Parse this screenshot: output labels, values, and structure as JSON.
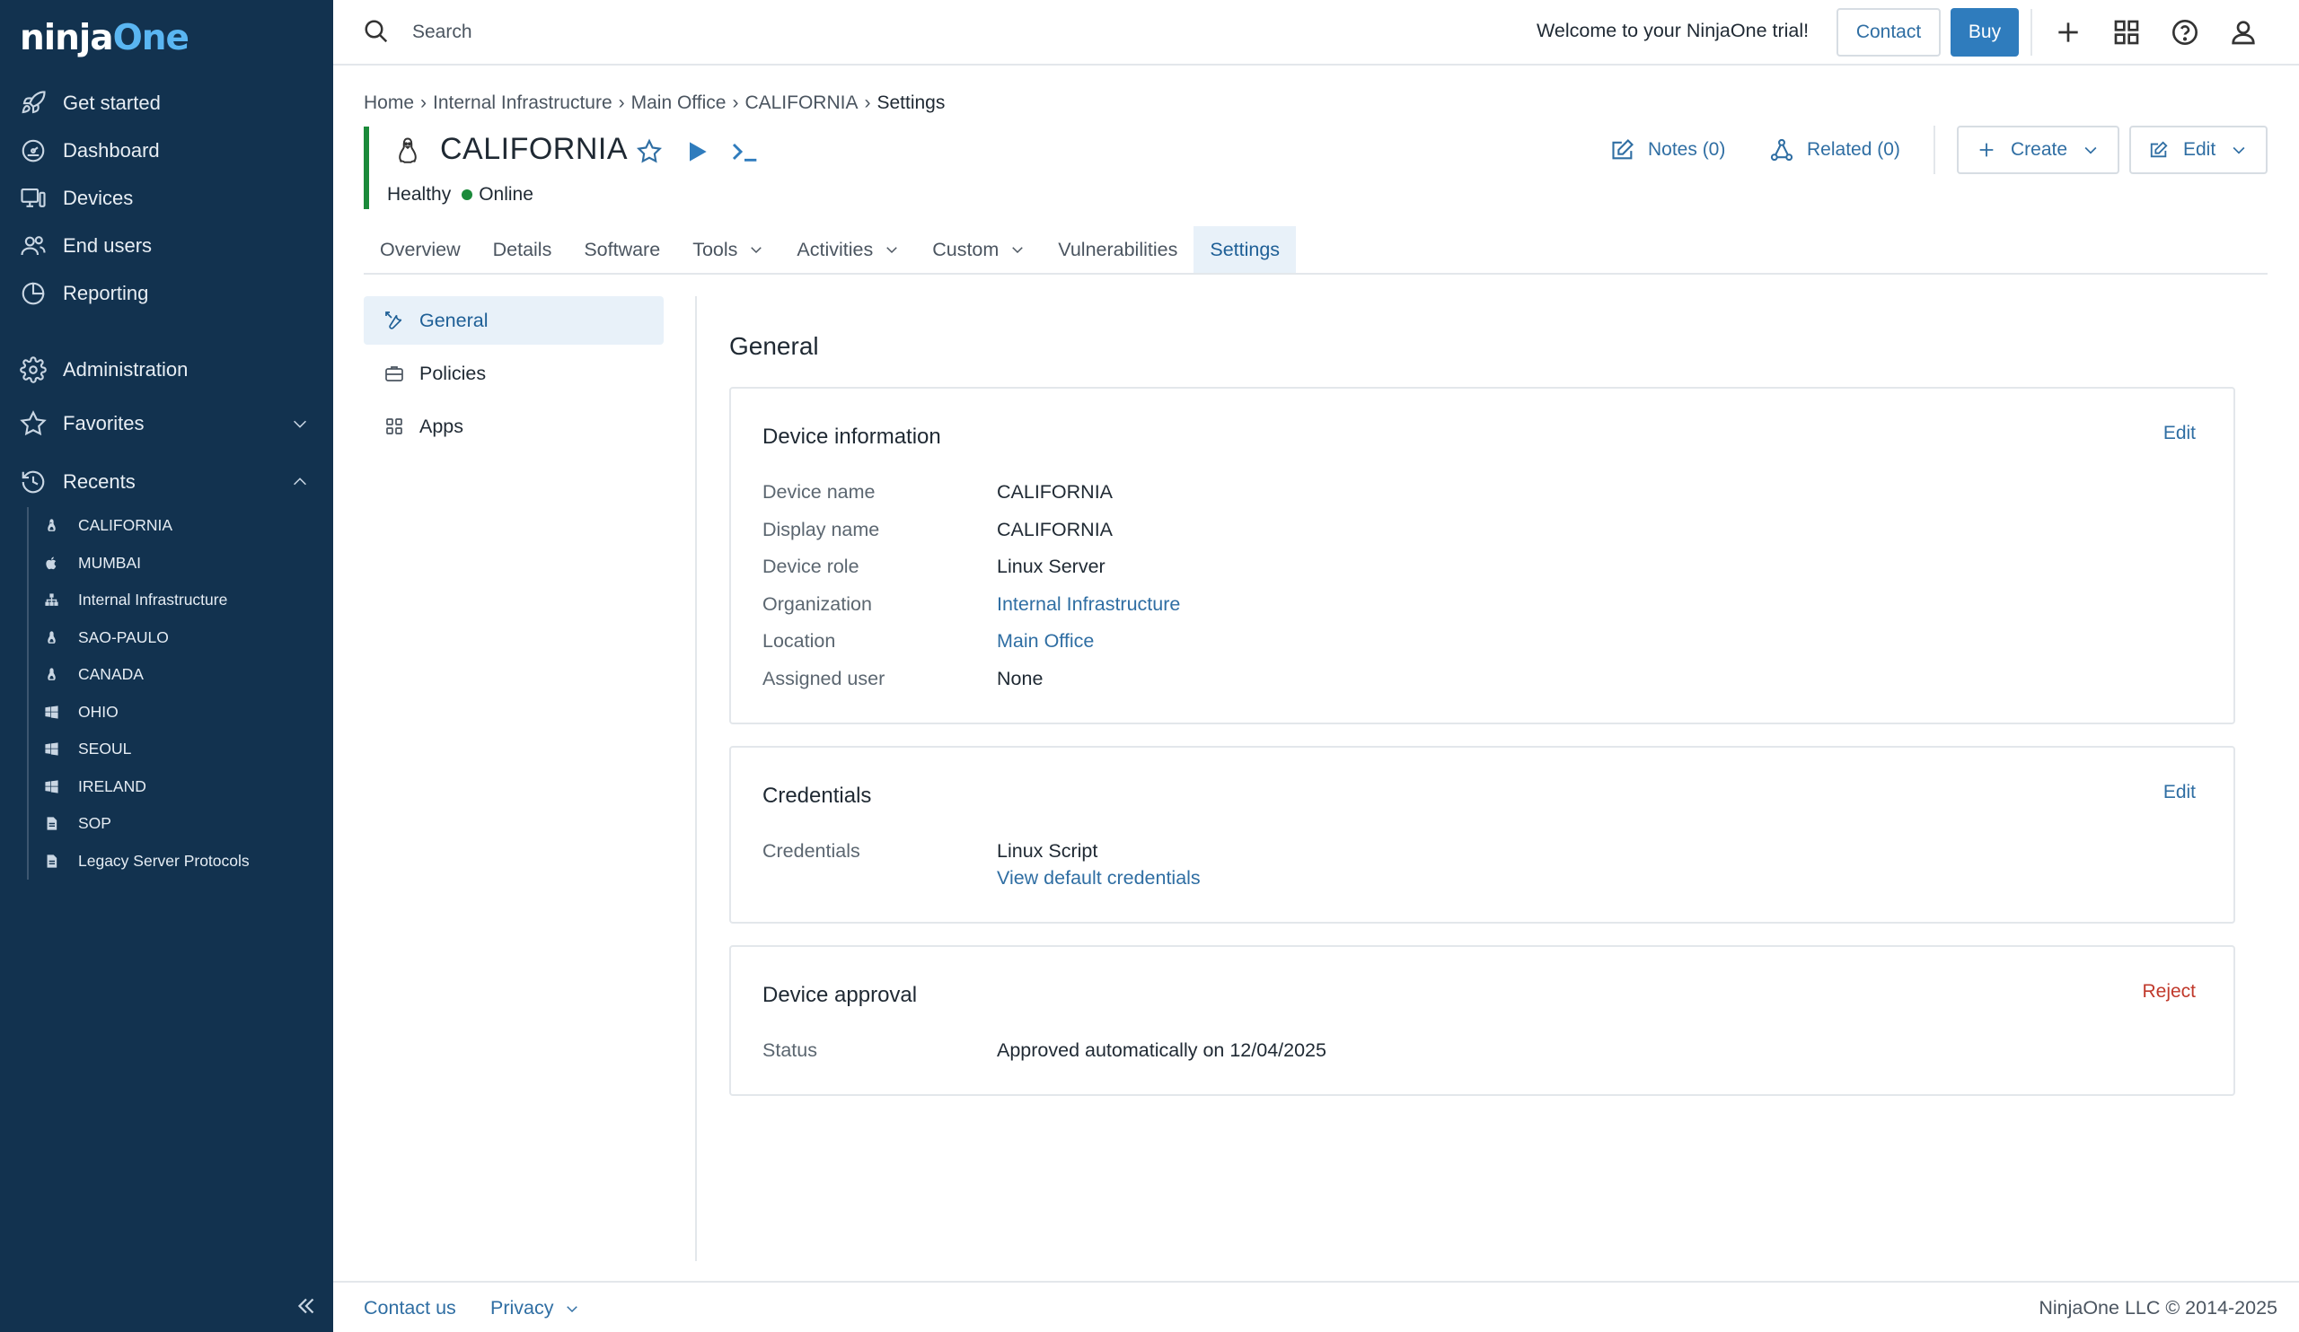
{
  "brand": {
    "name_part1": "ninja",
    "name_part2": "One"
  },
  "sidebar": {
    "main_items": [
      {
        "label": "Get started",
        "icon": "rocket-icon"
      },
      {
        "label": "Dashboard",
        "icon": "dashboard-gauge-icon"
      },
      {
        "label": "Devices",
        "icon": "devices-monitor-icon"
      },
      {
        "label": "End users",
        "icon": "users-icon"
      },
      {
        "label": "Reporting",
        "icon": "pie-chart-icon"
      }
    ],
    "administration_label": "Administration",
    "favorites_label": "Favorites",
    "recents_label": "Recents",
    "recents": [
      {
        "label": "CALIFORNIA",
        "icon": "linux-icon"
      },
      {
        "label": "MUMBAI",
        "icon": "apple-icon"
      },
      {
        "label": "Internal Infrastructure",
        "icon": "organization-icon"
      },
      {
        "label": "SAO-PAULO",
        "icon": "linux-icon"
      },
      {
        "label": "CANADA",
        "icon": "linux-icon"
      },
      {
        "label": "OHIO",
        "icon": "windows-icon"
      },
      {
        "label": "SEOUL",
        "icon": "windows-icon"
      },
      {
        "label": "IRELAND",
        "icon": "windows-icon"
      },
      {
        "label": "SOP",
        "icon": "document-icon"
      },
      {
        "label": "Legacy Server Protocols",
        "icon": "document-icon"
      }
    ]
  },
  "topbar": {
    "search_placeholder": "Search",
    "welcome": "Welcome to your NinjaOne trial!",
    "contact_label": "Contact",
    "buy_label": "Buy"
  },
  "breadcrumb": {
    "items": [
      "Home",
      "Internal Infrastructure",
      "Main Office",
      "CALIFORNIA"
    ],
    "current": "Settings"
  },
  "device": {
    "name": "CALIFORNIA",
    "health": "Healthy",
    "online_status": "Online",
    "notes_label": "Notes (0)",
    "related_label": "Related (0)",
    "create_label": "Create",
    "edit_label": "Edit"
  },
  "tabs": [
    {
      "label": "Overview",
      "dropdown": false
    },
    {
      "label": "Details",
      "dropdown": false
    },
    {
      "label": "Software",
      "dropdown": false
    },
    {
      "label": "Tools",
      "dropdown": true
    },
    {
      "label": "Activities",
      "dropdown": true
    },
    {
      "label": "Custom",
      "dropdown": true
    },
    {
      "label": "Vulnerabilities",
      "dropdown": false
    },
    {
      "label": "Settings",
      "dropdown": false,
      "active": true
    }
  ],
  "settings_menu": {
    "general": "General",
    "policies": "Policies",
    "apps": "Apps"
  },
  "content": {
    "title": "General",
    "device_info": {
      "title": "Device information",
      "edit_label": "Edit",
      "device_name_label": "Device name",
      "device_name": "CALIFORNIA",
      "display_name_label": "Display name",
      "display_name": "CALIFORNIA",
      "device_role_label": "Device role",
      "device_role": "Linux Server",
      "organization_label": "Organization",
      "organization": "Internal Infrastructure",
      "location_label": "Location",
      "location": "Main Office",
      "assigned_user_label": "Assigned user",
      "assigned_user": "None"
    },
    "credentials": {
      "title": "Credentials",
      "edit_label": "Edit",
      "credentials_label": "Credentials",
      "credentials_value": "Linux Script",
      "view_default": "View default credentials"
    },
    "approval": {
      "title": "Device approval",
      "reject_label": "Reject",
      "status_label": "Status",
      "status_value": "Approved automatically on 12/04/2025"
    }
  },
  "footer": {
    "contact_us": "Contact us",
    "privacy": "Privacy",
    "copyright": "NinjaOne LLC © 2014-2025"
  },
  "colors": {
    "sidebar_bg": "#12324f",
    "accent_blue": "#2f7cbd",
    "link_blue": "#2f6ea3",
    "healthy_green": "#1b8a3a",
    "reject_red": "#c0392b",
    "active_tab_bg": "#e8f1f9"
  }
}
